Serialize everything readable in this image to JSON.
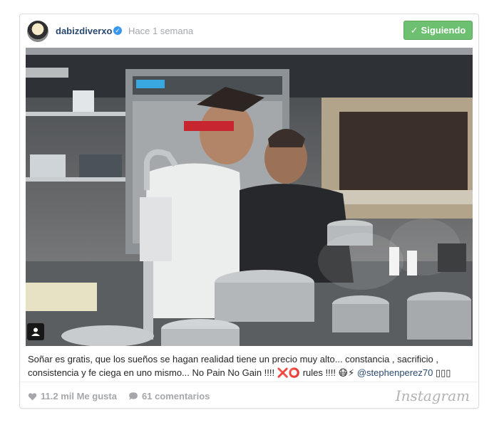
{
  "post": {
    "username": "dabizdiverxo",
    "verified_icon": "verified-badge-icon",
    "timestamp": "Hace 1 semana",
    "follow_button_label": "Siguiendo",
    "caption_text": "Soñar es gratis, que los sueños se hagan realidad tiene un precio muy alto... constancia , sacrificio , consistencia y fe ciega en uno mismo... No Pain No Gain !!!! ❌⭕ rules !!!! 😷⚡ ",
    "caption_mention": "@stephenperez70",
    "caption_trailing": " ▯▯▯",
    "likes_label": "11.2 mil Me gusta",
    "comments_label": "61 comentarios",
    "brand": "Instagram"
  },
  "colors": {
    "follow_green": "#6cc070",
    "username_blue": "#2b4a6f",
    "muted_gray": "#a5a7aa",
    "verified_blue": "#3897f0"
  }
}
